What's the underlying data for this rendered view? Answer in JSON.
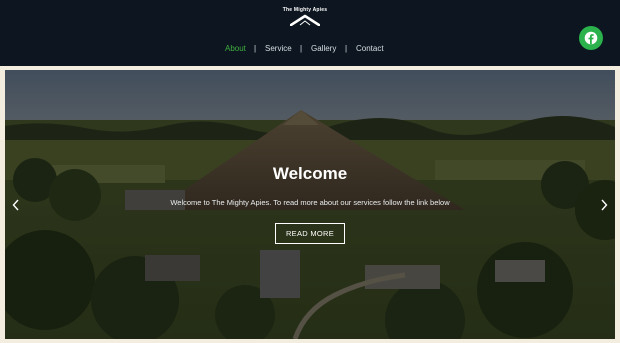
{
  "brand": {
    "name": "The Mighty Apies"
  },
  "nav": {
    "items": [
      {
        "label": "About",
        "active": true
      },
      {
        "label": "Service",
        "active": false
      },
      {
        "label": "Gallery",
        "active": false
      },
      {
        "label": "Contact",
        "active": false
      }
    ],
    "separator": "|"
  },
  "social": {
    "icon": "facebook-icon",
    "color": "#2bb24c"
  },
  "hero": {
    "title": "Welcome",
    "subtitle": "Welcome to The Mighty Apies. To read more about our services follow the link below",
    "button_label": "READ MORE",
    "prev_icon": "chevron-left-icon",
    "next_icon": "chevron-right-icon"
  },
  "colors": {
    "header_bg": "#0d1620",
    "active_nav": "#3fae3f",
    "page_bg": "#f3ede0"
  }
}
